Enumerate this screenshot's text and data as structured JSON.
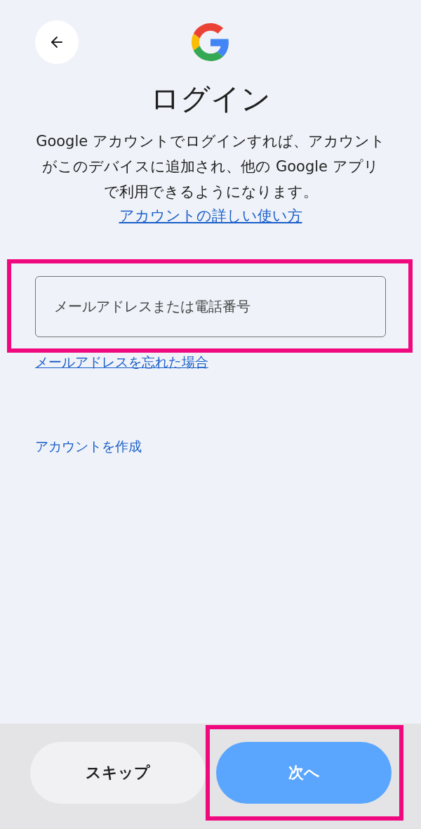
{
  "header": {
    "title": "ログイン",
    "description": "Google アカウントでログインすれば、アカウントがこのデバイスに追加され、他の Google アプリで利用できるようになります。",
    "help_link": "アカウントの詳しい使い方"
  },
  "email_field": {
    "placeholder": "メールアドレスまたは電話番号",
    "highlighted": true
  },
  "forgot_link": "メールアドレスを忘れた場合",
  "create_account_link": "アカウントを作成",
  "footer": {
    "buttons": [
      {
        "label": "スキップ",
        "kind": "secondary",
        "highlighted": false
      },
      {
        "label": "次へ",
        "kind": "primary",
        "highlighted": true
      }
    ]
  }
}
